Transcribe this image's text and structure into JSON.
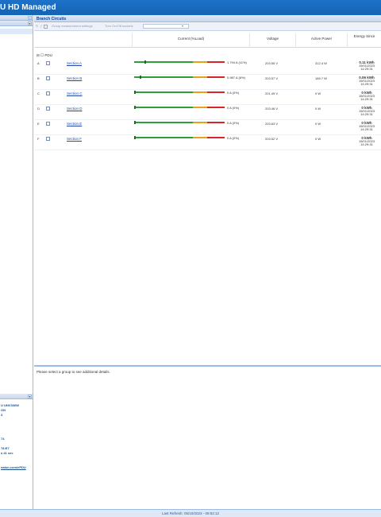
{
  "app_title": "U HD Managed",
  "branch_panel": {
    "title": "Branch Circuits"
  },
  "toolbar": {
    "buttons": [
      "Group measurement settings",
      "Turn On/Off sockets"
    ]
  },
  "columns": [
    "Current (%Load)",
    "Voltage",
    "Active Power",
    "Energy Since"
  ],
  "group_label": "PDU",
  "rows": [
    {
      "idx": "A",
      "name": "Section A",
      "current": "1.794 A (11%)",
      "voltage": "203.55 V",
      "power": "312.4 W",
      "energy": "0.11 kWh",
      "date": "15/01/2023",
      "time": "14:29:31",
      "load": 0.11
    },
    {
      "idx": "B",
      "name": "Section B",
      "current": "0.987 A (6%)",
      "voltage": "203.57 V",
      "power": "189.7 W",
      "energy": "0.06 kWh",
      "date": "15/01/2023",
      "time": "14:29:31",
      "load": 0.06
    },
    {
      "idx": "C",
      "name": "Section C",
      "current": "0 A (0%)",
      "voltage": "201.49 V",
      "power": "0 W",
      "energy": "0 kWh",
      "date": "15/01/2023",
      "time": "14:29:31",
      "load": 0
    },
    {
      "idx": "D",
      "name": "Section D",
      "current": "0 A (0%)",
      "voltage": "203.46 V",
      "power": "0 W",
      "energy": "0 kWh",
      "date": "15/01/2023",
      "time": "14:29:31",
      "load": 0
    },
    {
      "idx": "E",
      "name": "Section E",
      "current": "0 A (0%)",
      "voltage": "203.63 V",
      "power": "0 W",
      "energy": "0 kWh",
      "date": "15/01/2023",
      "time": "14:29:31",
      "load": 0
    },
    {
      "idx": "F",
      "name": "Section F",
      "current": "0 A (0%)",
      "voltage": "203.52 V",
      "power": "0 W",
      "energy": "0 kWh",
      "date": "15/01/2023",
      "time": "14:29:31",
      "load": 0
    }
  ],
  "details_message": "Please select a group to see additional details.",
  "info_lines": [
    "U UNV336W",
    "ON",
    "3",
    "",
    "",
    "",
    "",
    "74",
    "",
    "78:E7",
    "s 41 sec",
    "",
    "",
    "eaton.com/ePDU"
  ],
  "footer": "Last Refresh: 05/10/2023 - 09:52:12",
  "colors": {
    "header": "#1563b3",
    "accent": "#99bbe8",
    "load_ok": "#2e9d3c",
    "load_warn": "#e3a21a",
    "load_crit": "#d6262c"
  }
}
